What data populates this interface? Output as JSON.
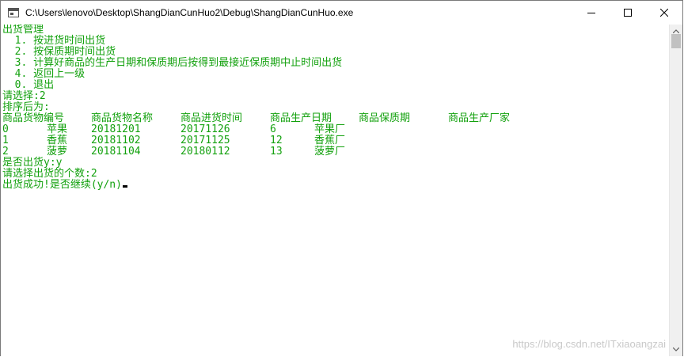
{
  "window": {
    "title": "C:\\Users\\lenovo\\Desktop\\ShangDianCunHuo2\\Debug\\ShangDianCunHuo.exe",
    "minimize_icon": "minimize-icon",
    "maximize_icon": "maximize-icon",
    "close_icon": "close-icon"
  },
  "console": {
    "text_color": "#13a10e",
    "background": "#ffffff",
    "menu_title": "出货管理",
    "menu_items": [
      "  1. 按进货时间出货",
      "  2. 按保质期时间出货",
      "  3. 计算好商品的生产日期和保质期后按得到最接近保质期中止时间出货",
      "  4. 返回上一级",
      "  0. 退出"
    ],
    "prompt_choice": "请选择:2",
    "sorted_label": "排序后为:",
    "table": {
      "headers": [
        "商品货物编号",
        "商品货物名称",
        "商品进货时间",
        "商品生产日期",
        "商品保质期",
        "商品生产厂家"
      ],
      "rows": [
        [
          "0",
          "苹果",
          "20181201",
          "20171126",
          "6",
          "苹果厂"
        ],
        [
          "1",
          "香蕉",
          "20181102",
          "20171125",
          "12",
          "香蕉厂"
        ],
        [
          "2",
          "菠萝",
          "20181104",
          "20180112",
          "13",
          "菠萝厂"
        ]
      ]
    },
    "confirm_ship": "是否出货y:y",
    "prompt_count": "请选择出货的个数:2",
    "result": "出货成功!是否继续(y/n)"
  },
  "watermark": "https://blog.csdn.net/ITxiaoangzai"
}
